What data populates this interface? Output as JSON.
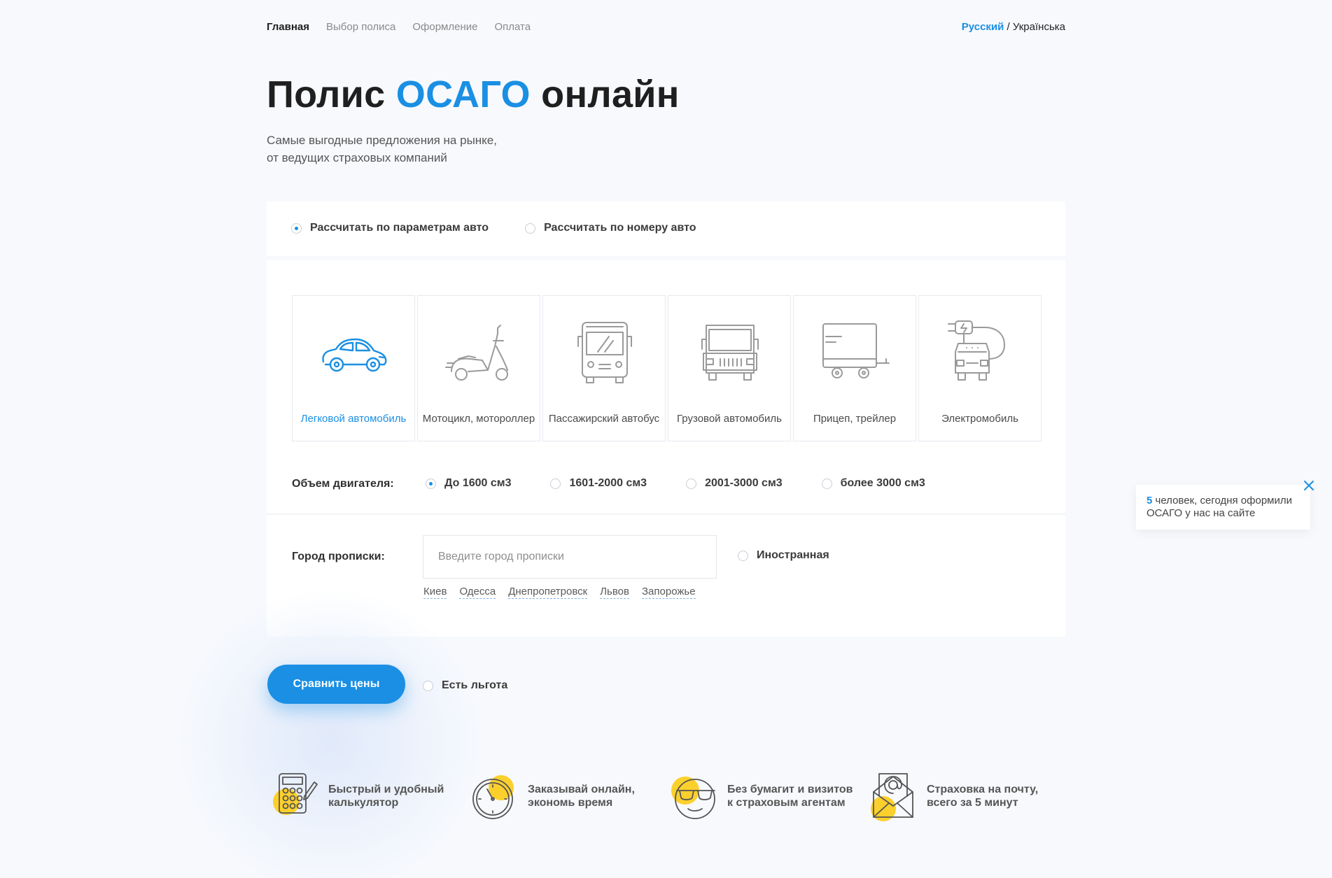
{
  "nav": {
    "items": [
      {
        "label": "Главная",
        "active": true
      },
      {
        "label": "Выбор полиса",
        "active": false
      },
      {
        "label": "Оформление",
        "active": false
      },
      {
        "label": "Оплата",
        "active": false
      }
    ],
    "lang_current": "Русский",
    "lang_sep": " / ",
    "lang_other": "Українська"
  },
  "hero": {
    "title_pre": "Полис ",
    "title_accent": "ОСАГО",
    "title_post": " онлайн",
    "subtitle_line1": "Самые выгодные предложения на рынке,",
    "subtitle_line2": "от ведущих страховых компаний"
  },
  "mode": {
    "options": [
      {
        "label": "Рассчитать по параметрам авто",
        "checked": true
      },
      {
        "label": "Рассчитать по номеру авто",
        "checked": false
      }
    ]
  },
  "vehicles": [
    {
      "label": "Легковой автомобиль",
      "icon": "car-icon",
      "active": true
    },
    {
      "label": "Мотоцикл, мотороллер",
      "icon": "scooter-icon",
      "active": false
    },
    {
      "label": "Пассажирский автобус",
      "icon": "bus-icon",
      "active": false
    },
    {
      "label": "Грузовой автомобиль",
      "icon": "truck-icon",
      "active": false
    },
    {
      "label": "Прицеп, трейлер",
      "icon": "trailer-icon",
      "active": false
    },
    {
      "label": "Электромобиль",
      "icon": "electric-car-icon",
      "active": false
    }
  ],
  "engine": {
    "label": "Объем двигателя:",
    "options": [
      {
        "label": "До 1600 см3",
        "checked": true
      },
      {
        "label": "1601-2000 см3",
        "checked": false
      },
      {
        "label": "2001-3000 см3",
        "checked": false
      },
      {
        "label": "более 3000 см3",
        "checked": false
      }
    ]
  },
  "city": {
    "label": "Город прописки:",
    "placeholder": "Введите город прописки",
    "value": "",
    "foreign_label": "Иностранная",
    "quick": [
      "Киев",
      "Одесса",
      "Днепропетровск",
      "Львов",
      "Запорожье"
    ]
  },
  "actions": {
    "compare_label": "Сравнить цены",
    "benefit_label": "Есть льгота"
  },
  "features": [
    {
      "line1": "Быстрый и удобный",
      "line2": "калькулятор",
      "icon": "calculator-icon"
    },
    {
      "line1": "Заказывай онлайн,",
      "line2": "экономь время",
      "icon": "clock-icon"
    },
    {
      "line1": "Без бумагит и визитов",
      "line2": "к страховым агентам",
      "icon": "sunglasses-face-icon"
    },
    {
      "line1": "Страховка на почту,",
      "line2": "всего за 5 минут",
      "icon": "envelope-icon"
    }
  ],
  "toast": {
    "count": "5",
    "text_line1": " человек, сегодня оформили",
    "text_line2": "ОСАГО у нас на сайте"
  },
  "colors": {
    "accent": "#1a8fe3",
    "yellow": "#fcd02c",
    "background": "#f7f9fd"
  }
}
